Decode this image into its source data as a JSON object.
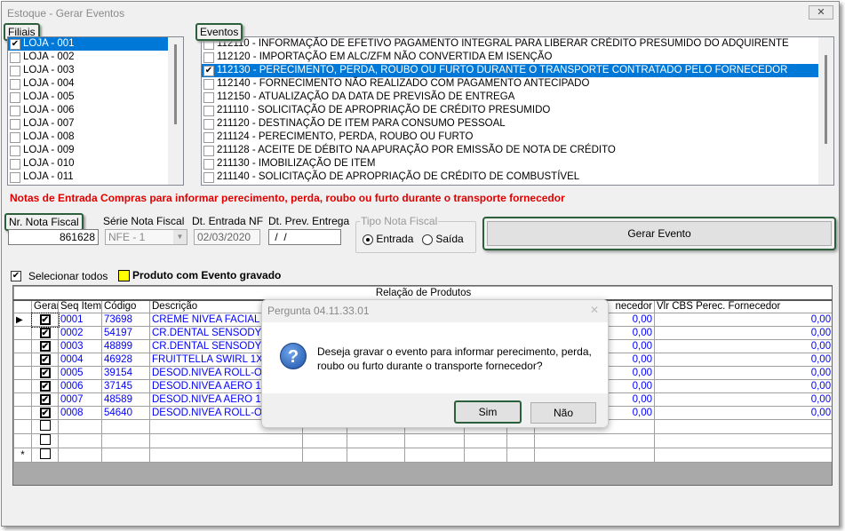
{
  "window": {
    "title": "Estoque - Gerar Eventos",
    "close": "✕"
  },
  "filiais": {
    "label": "Filiais",
    "items": [
      {
        "label": "LOJA - 001",
        "checked": true,
        "selected": true
      },
      {
        "label": "LOJA - 002"
      },
      {
        "label": "LOJA - 003"
      },
      {
        "label": "LOJA - 004"
      },
      {
        "label": "LOJA - 005"
      },
      {
        "label": "LOJA - 006"
      },
      {
        "label": "LOJA - 007"
      },
      {
        "label": "LOJA - 008"
      },
      {
        "label": "LOJA - 009"
      },
      {
        "label": "LOJA - 010"
      },
      {
        "label": "LOJA - 011"
      }
    ]
  },
  "eventos": {
    "label": "Eventos",
    "items": [
      {
        "label": "112110 - INFORMAÇÃO DE EFETIVO PAGAMENTO INTEGRAL PARA LIBERAR CRÉDITO PRESUMIDO DO ADQUIRENTE"
      },
      {
        "label": "112120 - IMPORTAÇÃO EM ALC/ZFM NÃO CONVERTIDA EM ISENÇÃO"
      },
      {
        "label": "112130 - PERECIMENTO, PERDA, ROUBO OU FURTO DURANTE O TRANSPORTE CONTRATADO PELO FORNECEDOR",
        "checked": true,
        "selected": true
      },
      {
        "label": "112140 - FORNECIMENTO NÃO REALIZADO COM PAGAMENTO ANTECIPADO"
      },
      {
        "label": "112150 - ATUALIZAÇÃO DA DATA DE PREVISÃO DE ENTREGA"
      },
      {
        "label": "211110 - SOLICITAÇÃO DE APROPRIAÇÃO DE CRÉDITO PRESUMIDO"
      },
      {
        "label": "211120 - DESTINAÇÃO DE ITEM PARA CONSUMO PESSOAL"
      },
      {
        "label": "211124 - PERECIMENTO, PERDA, ROUBO OU FURTO"
      },
      {
        "label": "211128 - ACEITE DE DÉBITO NA APURAÇÃO POR EMISSÃO DE NOTA DE CRÉDITO"
      },
      {
        "label": "211130 - IMOBILIZAÇÃO DE ITEM"
      },
      {
        "label": "211140 - SOLICITAÇÃO DE APROPRIAÇÃO DE CRÉDITO DE COMBUSTÍVEL"
      }
    ]
  },
  "notice": "Notas de Entrada Compras para informar perecimento, perda, roubo ou furto durante o transporte fornecedor",
  "form": {
    "nr_label": "Nr. Nota Fiscal",
    "nr_value": "861628",
    "serie_label": "Série Nota Fiscal",
    "serie_value": "NFE - 1",
    "dt_entrada_label": "Dt. Entrada NF",
    "dt_entrada_value": "02/03/2020",
    "dt_prev_label": "Dt. Prev. Entrega",
    "dt_prev_value": " /  /",
    "tipo_label": "Tipo Nota Fiscal",
    "tipo_entrada": "Entrada",
    "tipo_saida": "Saída",
    "gerar_label": "Gerar Evento"
  },
  "grid": {
    "select_all": "Selecionar todos",
    "legend": "Produto com Evento gravado",
    "legend_color": "#ffff00",
    "group_header": "Relação de Produtos",
    "headers": [
      "Gerar",
      "Seq Item",
      "Código",
      "Descrição",
      "",
      "",
      "",
      "",
      "",
      "necedor",
      "Vlr CBS Perec. Fornecedor"
    ],
    "rows": [
      {
        "seq": "0001",
        "cod": "73698",
        "desc": "CREME NIVEA FACIAL 10",
        "v1": "0,00",
        "v2": "0,00"
      },
      {
        "seq": "0002",
        "cod": "54197",
        "desc": "CR.DENTAL SENSODYNE",
        "v1": "0,00",
        "v2": "0,00"
      },
      {
        "seq": "0003",
        "cod": "48899",
        "desc": "CR.DENTAL SENSODYNE",
        "v1": "0,00",
        "v2": "0,00"
      },
      {
        "seq": "0004",
        "cod": "46928",
        "desc": "FRUITTELLA SWIRL 1X1",
        "v1": "0,00",
        "v2": "0,00"
      },
      {
        "seq": "0005",
        "cod": "39154",
        "desc": "DESOD.NIVEA ROLL-ON",
        "v1": "0,00",
        "v2": "0,00"
      },
      {
        "seq": "0006",
        "cod": "37145",
        "desc": "DESOD.NIVEA AERO 150",
        "v1": "0,00",
        "v2": "0,00"
      },
      {
        "seq": "0007",
        "cod": "48589",
        "desc": "DESOD.NIVEA AERO 150",
        "v1": "0,00",
        "v2": "0,00"
      },
      {
        "seq": "0008",
        "cod": "54640",
        "desc": "DESOD.NIVEA ROLL-ON",
        "v1": "0,00",
        "v2": "0,00"
      }
    ],
    "new_row_marker": "*"
  },
  "dialog": {
    "title": "Pergunta 04.11.33.01",
    "close": "✕",
    "icon": "?",
    "message": "Deseja gravar o evento para informar perecimento, perda, roubo ou furto durante o transporte fornecedor?",
    "yes": "Sim",
    "no": "Não"
  }
}
